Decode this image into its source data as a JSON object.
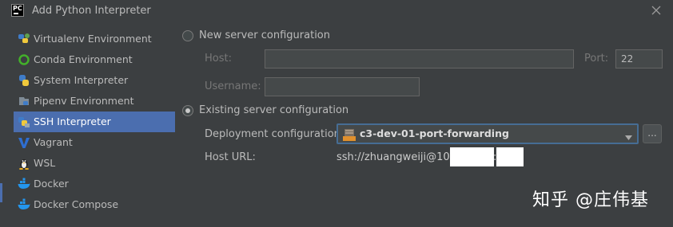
{
  "window": {
    "title": "Add Python Interpreter",
    "app_logo_text": "PC"
  },
  "sidebar": {
    "items": [
      {
        "label": "Virtualenv Environment",
        "icon": "virtualenv-icon"
      },
      {
        "label": "Conda Environment",
        "icon": "conda-icon"
      },
      {
        "label": "System Interpreter",
        "icon": "python-icon"
      },
      {
        "label": "Pipenv Environment",
        "icon": "pipenv-icon"
      },
      {
        "label": "SSH Interpreter",
        "icon": "ssh-icon",
        "selected": true
      },
      {
        "label": "Vagrant",
        "icon": "vagrant-icon"
      },
      {
        "label": "WSL",
        "icon": "linux-icon"
      },
      {
        "label": "Docker",
        "icon": "docker-icon"
      },
      {
        "label": "Docker Compose",
        "icon": "docker-compose-icon"
      }
    ]
  },
  "new_server": {
    "radio_label": "New server configuration",
    "selected": false,
    "host_label": "Host:",
    "host_value": "",
    "port_label": "Port:",
    "port_value": "22",
    "username_label": "Username:",
    "username_value": ""
  },
  "existing_server": {
    "radio_label": "Existing server configuration",
    "selected": true,
    "deployment_label": "Deployment configuration:",
    "deployment_value": "c3-dev-01-port-forwarding",
    "deployment_icon_text": "SFTP",
    "more_button": "...",
    "host_url_label": "Host URL:",
    "host_url_value": "ssh://zhuangweiji@10.22"
  },
  "watermark": "知乎 @庄伟基",
  "colors": {
    "background": "#3c3f41",
    "selection": "#4b6eaf",
    "focus_border": "#466d94",
    "text": "#bbbbbb",
    "disabled_text": "#777777"
  }
}
